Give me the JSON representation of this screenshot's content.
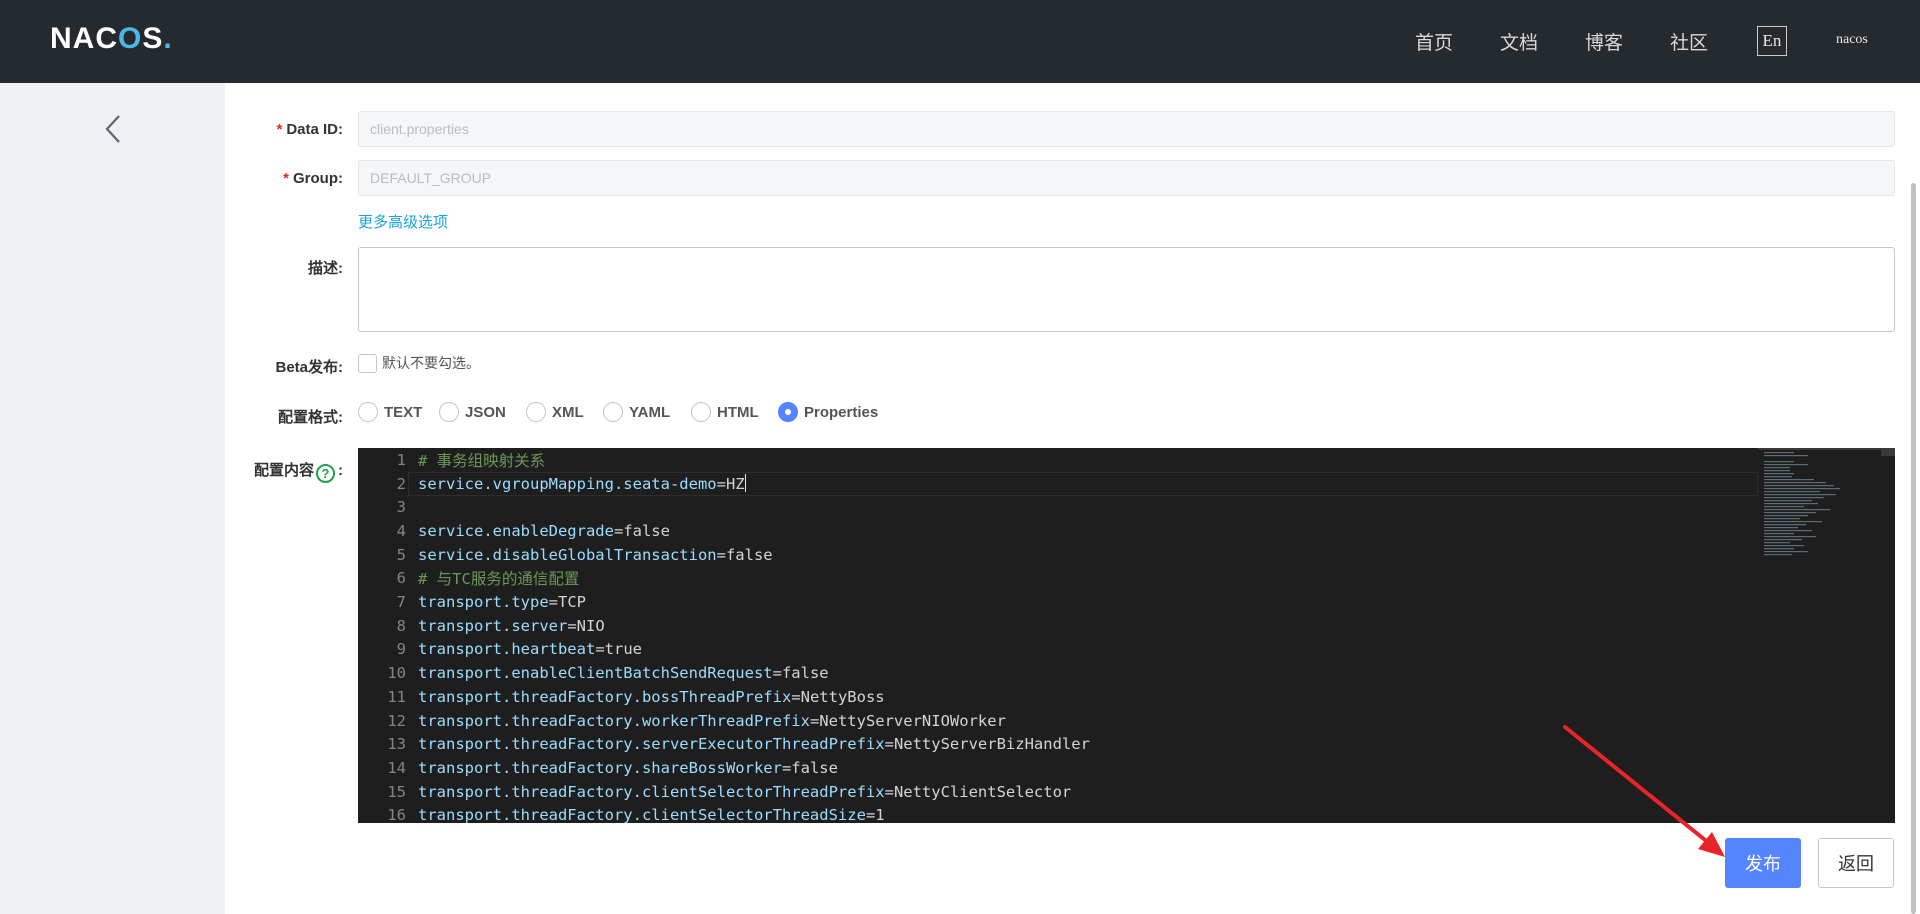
{
  "header": {
    "logo": {
      "part1": "NAC",
      "part2": "O",
      "part3": "S",
      "dot": "."
    },
    "nav": [
      "首页",
      "文档",
      "博客",
      "社区"
    ],
    "lang": "En",
    "user": "nacos"
  },
  "form": {
    "data_id": {
      "label": "Data ID:",
      "value": "client.properties"
    },
    "group": {
      "label": "Group:",
      "value": "DEFAULT_GROUP"
    },
    "required_mark": "*",
    "advanced_link": "更多高级选项",
    "description_label": "描述:",
    "beta": {
      "label": "Beta发布:",
      "text": "默认不要勾选。"
    },
    "format": {
      "label": "配置格式:",
      "options": [
        "TEXT",
        "JSON",
        "XML",
        "YAML",
        "HTML",
        "Properties"
      ],
      "selected": "Properties"
    },
    "content_label": "配置内容",
    "content_label_colon": ":",
    "help_icon": "?"
  },
  "editor": {
    "lines": [
      {
        "num": "1",
        "comment": "# 事务组映射关系"
      },
      {
        "num": "2",
        "key": "service.vgroupMapping.seata-demo",
        "eq": "=",
        "val": "HZ"
      },
      {
        "num": "3"
      },
      {
        "num": "4",
        "key": "service.enableDegrade",
        "eq": "=",
        "val": "false"
      },
      {
        "num": "5",
        "key": "service.disableGlobalTransaction",
        "eq": "=",
        "val": "false"
      },
      {
        "num": "6",
        "comment": "# 与TC服务的通信配置"
      },
      {
        "num": "7",
        "key": "transport.type",
        "eq": "=",
        "val": "TCP"
      },
      {
        "num": "8",
        "key": "transport.server",
        "eq": "=",
        "val": "NIO"
      },
      {
        "num": "9",
        "key": "transport.heartbeat",
        "eq": "=",
        "val": "true"
      },
      {
        "num": "10",
        "key": "transport.enableClientBatchSendRequest",
        "eq": "=",
        "val": "false"
      },
      {
        "num": "11",
        "key": "transport.threadFactory.bossThreadPrefix",
        "eq": "=",
        "val": "NettyBoss"
      },
      {
        "num": "12",
        "key": "transport.threadFactory.workerThreadPrefix",
        "eq": "=",
        "val": "NettyServerNIOWorker"
      },
      {
        "num": "13",
        "key": "transport.threadFactory.serverExecutorThreadPrefix",
        "eq": "=",
        "val": "NettyServerBizHandler"
      },
      {
        "num": "14",
        "key": "transport.threadFactory.shareBossWorker",
        "eq": "=",
        "val": "false"
      },
      {
        "num": "15",
        "key": "transport.threadFactory.clientSelectorThreadPrefix",
        "eq": "=",
        "val": "NettyClientSelector"
      },
      {
        "num": "16",
        "key": "transport.threadFactory.clientSelectorThreadSize",
        "eq": "=",
        "val": "1"
      }
    ]
  },
  "buttons": {
    "publish": "发布",
    "back": "返回"
  },
  "colors": {
    "header_bg": "#252a2f",
    "primary": "#5584ff",
    "link": "#19a5d8",
    "required": "#e1291e",
    "annotation_arrow": "#e8232a"
  }
}
